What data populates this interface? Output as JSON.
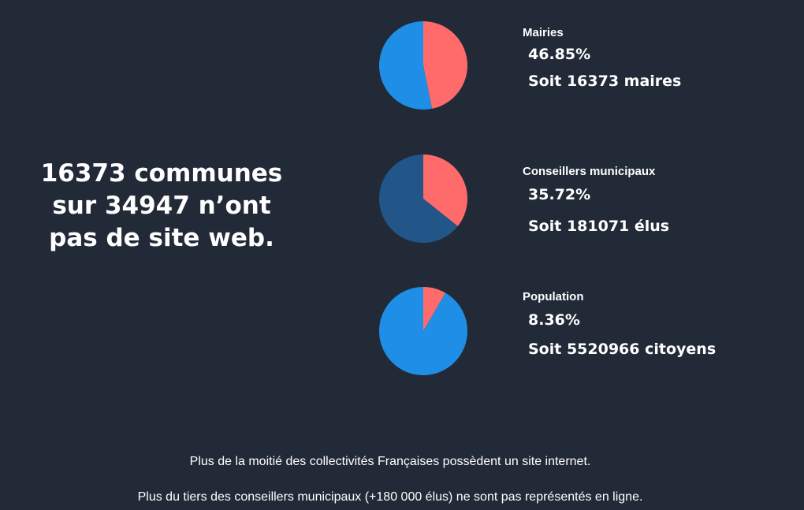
{
  "headline": {
    "line1": "16373 communes",
    "line2": "sur 34947 n’ont",
    "line3": "pas de site web."
  },
  "chart_data": [
    {
      "type": "pie",
      "title": "Mairies",
      "percent_label": "46.85%",
      "detail": "Soit 16373 maires",
      "slices": [
        {
          "label": "sans site web",
          "value": 46.85,
          "color": "#ff6b6b"
        },
        {
          "label": "avec site web",
          "value": 53.15,
          "color": "#1e8ee6"
        }
      ]
    },
    {
      "type": "pie",
      "title": "Conseillers municipaux",
      "percent_label": "35.72%",
      "detail": "Soit 181071 élus",
      "slices": [
        {
          "label": "sans site web",
          "value": 35.72,
          "color": "#ff6b6b"
        },
        {
          "label": "avec site web",
          "value": 64.28,
          "color": "#235688"
        }
      ]
    },
    {
      "type": "pie",
      "title": "Population",
      "percent_label": "8.36%",
      "detail": "Soit 5520966 citoyens",
      "slices": [
        {
          "label": "sans site web",
          "value": 8.36,
          "color": "#ff6b6b"
        },
        {
          "label": "avec site web",
          "value": 91.64,
          "color": "#1e8ee6"
        }
      ]
    }
  ],
  "footer": {
    "line1": "Plus de la moitié des collectivités Françaises possèdent un site internet.",
    "line2": "Plus du tiers des conseillers municipaux (+180 000 élus) ne sont pas représentés en ligne."
  }
}
